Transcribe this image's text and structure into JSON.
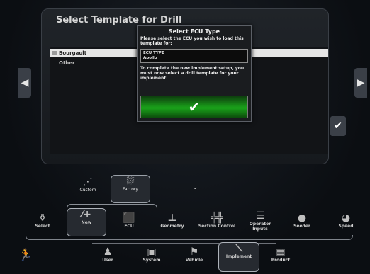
{
  "page": {
    "title": "Select Template for Drill"
  },
  "template_list": {
    "items": [
      {
        "label": "Bourgault",
        "selected": true
      },
      {
        "label": "Other",
        "selected": false
      }
    ],
    "scroll_icon": "chevron-down-icon"
  },
  "dialog": {
    "title": "Select ECU Type",
    "message": "Please select the ECU you wish to load this template for:",
    "ecu_type_label": "ECU TYPE",
    "ecu_type_value": "Apollo",
    "message2": "To complete the new implement setup, you must now select a drill template for your implement.",
    "confirm_icon": "checkmark-icon"
  },
  "template_source": {
    "custom_label": "Custom",
    "factory_label": "Factory"
  },
  "setup_tabs": [
    {
      "label": "Select",
      "icon": "basket-icon",
      "active": false
    },
    {
      "label": "New",
      "icon": "wand-plus-icon",
      "active": true
    },
    {
      "label": "ECU",
      "icon": "ecu-icon",
      "active": false
    },
    {
      "label": "Geometry",
      "icon": "geometry-icon",
      "active": false
    },
    {
      "label": "Section Control",
      "icon": "sections-icon",
      "active": false
    },
    {
      "label": "Operator Inputs",
      "icon": "operator-inputs-icon",
      "active": false
    },
    {
      "label": "Seeder",
      "icon": "seeder-icon",
      "active": false
    },
    {
      "label": "Speed",
      "icon": "speed-icon",
      "active": false
    }
  ],
  "dock": [
    {
      "label": "User",
      "icon": "user-icon",
      "active": false
    },
    {
      "label": "System",
      "icon": "system-icon",
      "active": false
    },
    {
      "label": "Vehicle",
      "icon": "vehicle-icon",
      "active": false
    },
    {
      "label": "Implement",
      "icon": "implement-icon",
      "active": true
    },
    {
      "label": "Product",
      "icon": "product-icon",
      "active": false
    }
  ],
  "colors": {
    "confirm_green": "#1aa31a",
    "background": "#0b0e12"
  }
}
